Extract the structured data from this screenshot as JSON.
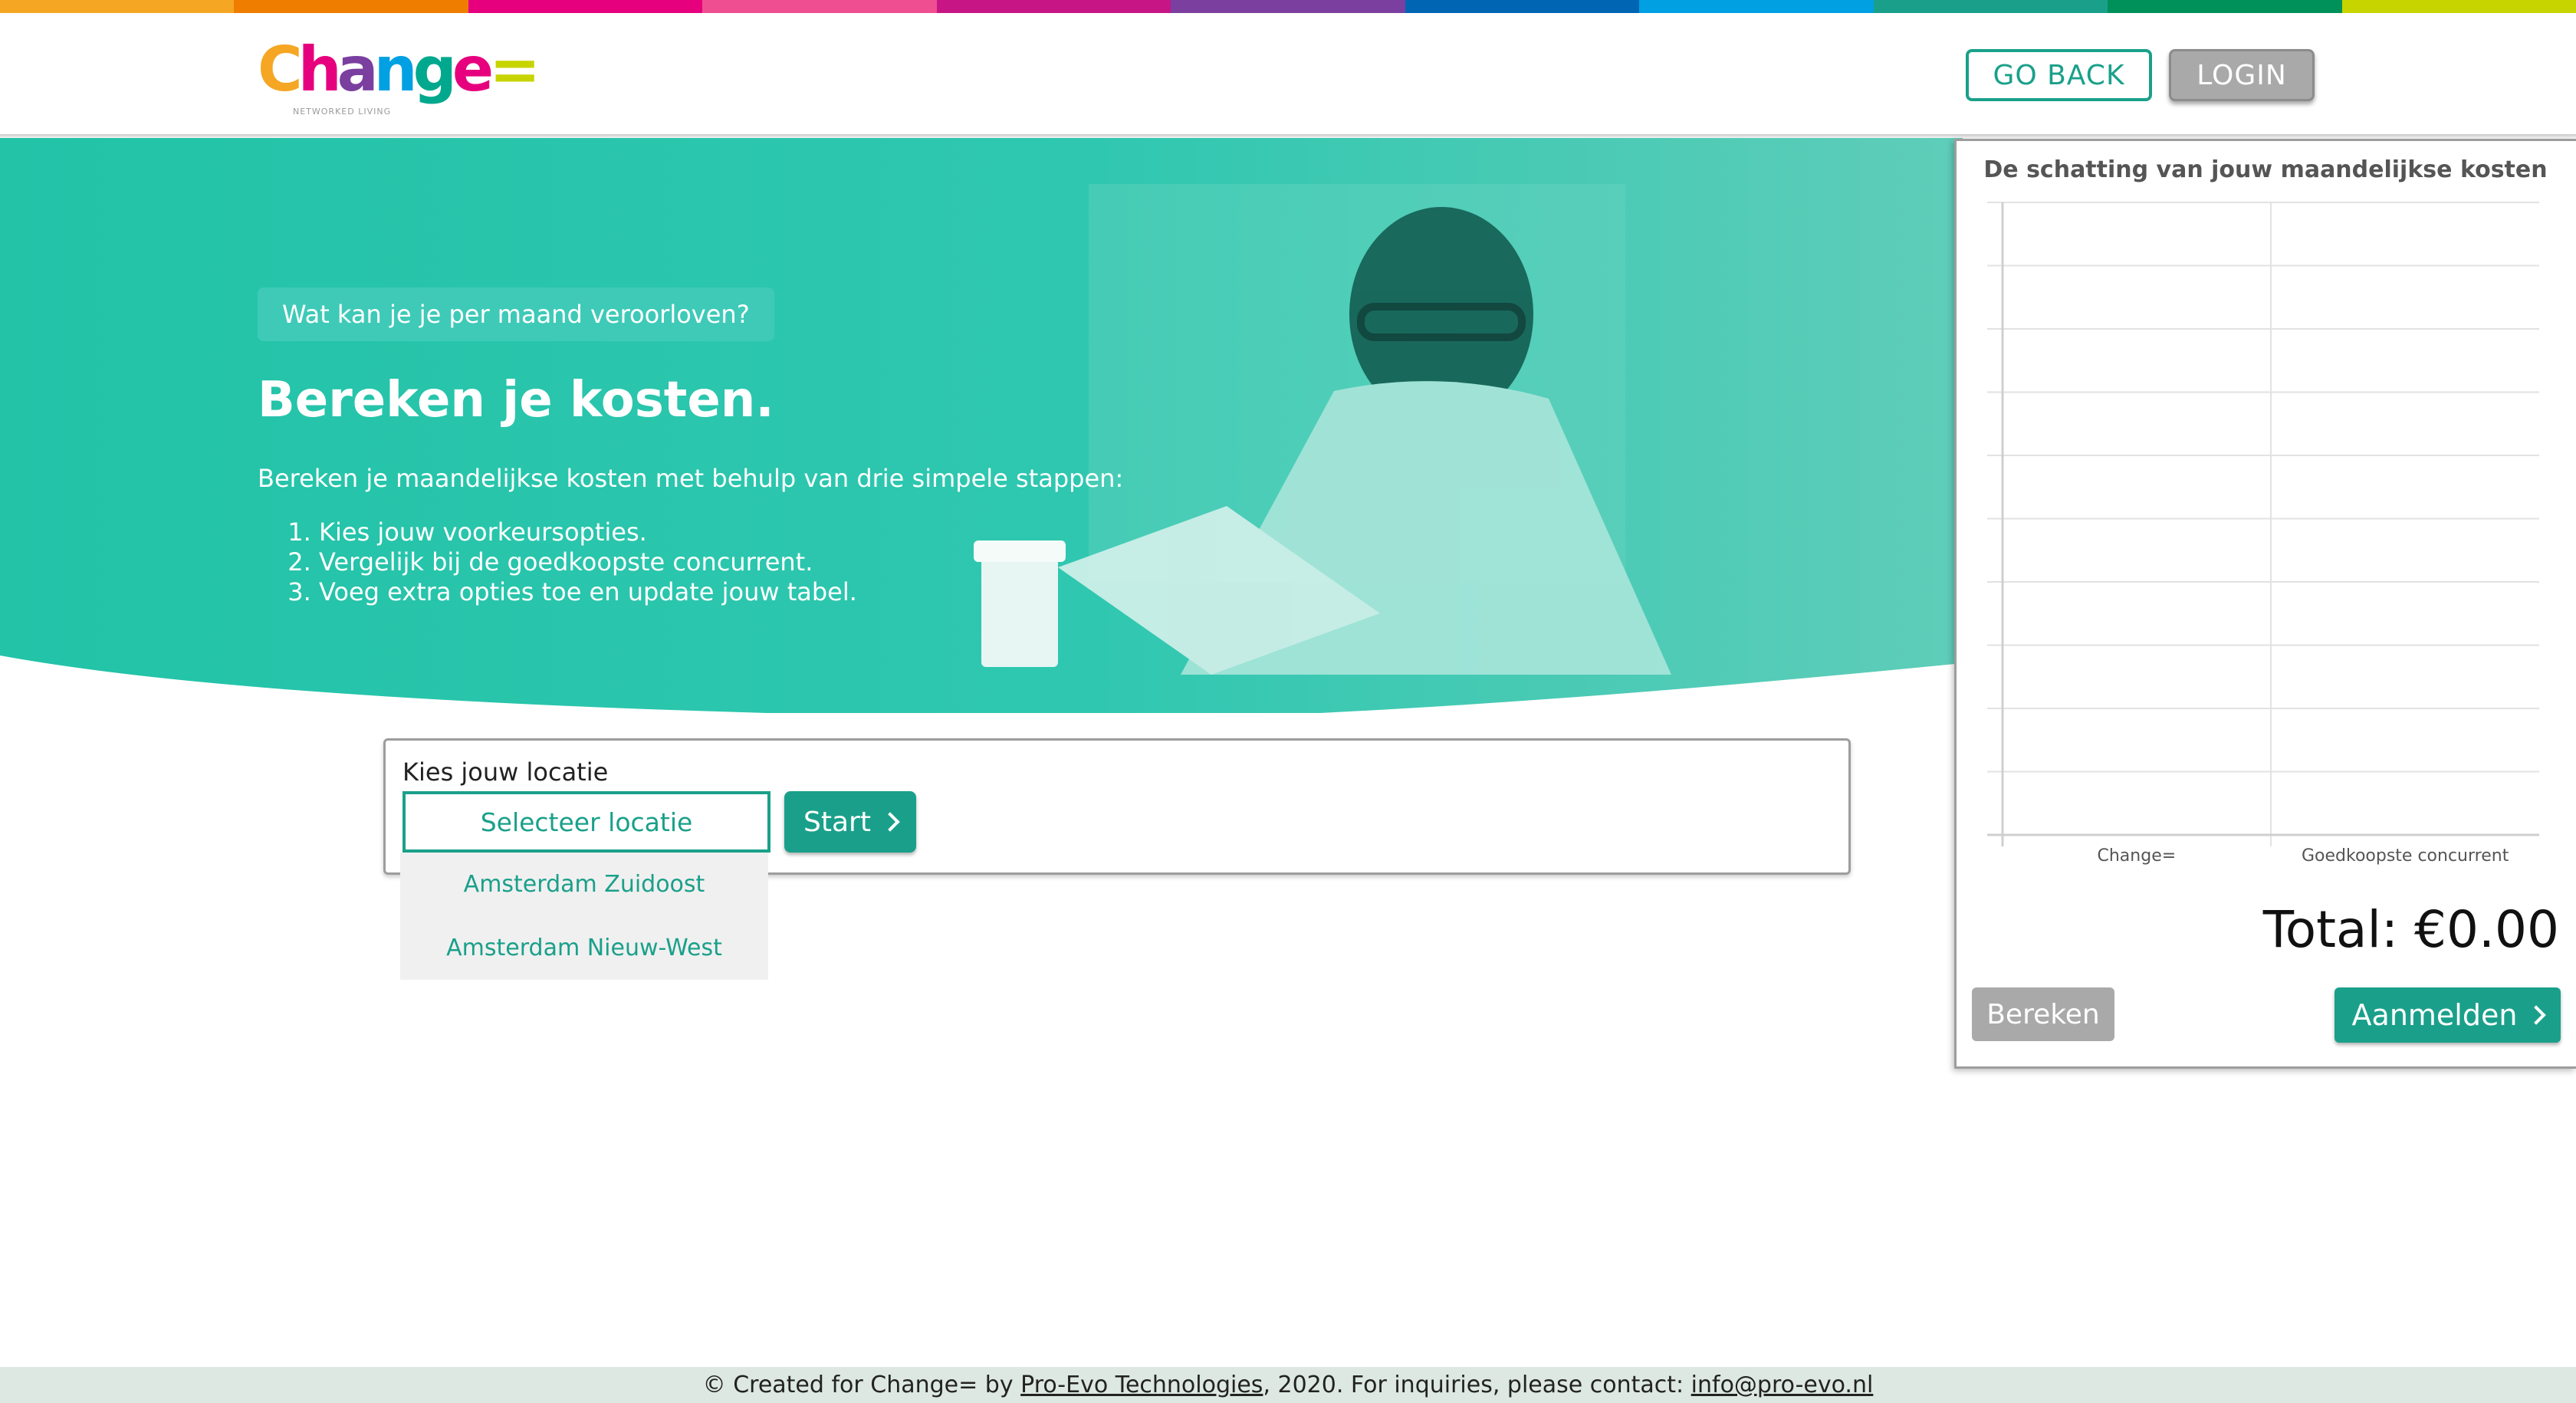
{
  "rainbow_colors": [
    "#f5a623",
    "#ef7d00",
    "#e6007e",
    "#ef4f91",
    "#c71585",
    "#7b3fa0",
    "#0066b3",
    "#00a0e3",
    "#1aa08a",
    "#00915a",
    "#c8d400"
  ],
  "brand": {
    "logo_text": "Change=",
    "tagline": "NETWORKED LIVING"
  },
  "header": {
    "go_back": "GO BACK",
    "login": "LOGIN"
  },
  "hero": {
    "badge": "Wat kan je je per maand veroorloven?",
    "title": "Bereken je kosten.",
    "intro": "Bereken je maandelijkse kosten met behulp van drie simpele stappen:",
    "steps": [
      "Kies jouw voorkeursopties.",
      "Vergelijk bij de goedkoopste concurrent.",
      "Voeg extra opties toe en update jouw tabel."
    ]
  },
  "location": {
    "label": "Kies jouw locatie",
    "select_placeholder": "Selecteer locatie",
    "start": "Start",
    "options": [
      "Amsterdam Zuidoost",
      "Amsterdam Nieuw-West"
    ]
  },
  "chart_data": {
    "type": "bar",
    "title": "De schatting van jouw maandelijkse kosten",
    "categories": [
      "Change=",
      "Goedkoopste concurrent"
    ],
    "values": [
      0,
      0
    ],
    "grid": true
  },
  "summary": {
    "total": "Total: €0.00",
    "bereken": "Bereken",
    "aanmelden": "Aanmelden"
  },
  "footer": {
    "prefix": "© Created for Change= by ",
    "company": "Pro-Evo Technologies",
    "middle": ", 2020. For inquiries, please contact: ",
    "email": "info@pro-evo.nl"
  },
  "colors": {
    "accent": "#1aa08a",
    "hero": "#2bc4ac",
    "muted": "#a9a9a9"
  }
}
